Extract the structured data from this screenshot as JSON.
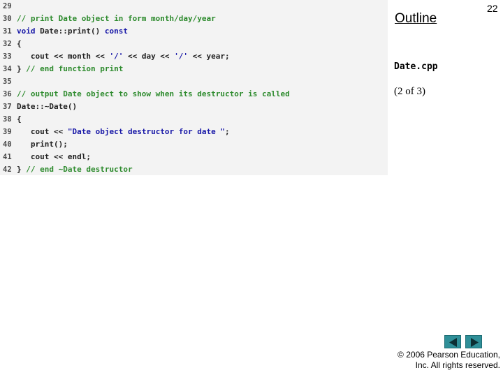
{
  "code": {
    "lines": [
      {
        "num": "29",
        "tokens": []
      },
      {
        "num": "30",
        "tokens": [
          {
            "t": "// print Date object in form month/day/year",
            "k": "comment"
          }
        ]
      },
      {
        "num": "31",
        "tokens": [
          {
            "t": "void",
            "k": "keyword"
          },
          {
            "t": " Date::print() ",
            "k": "plain"
          },
          {
            "t": "const",
            "k": "keyword"
          }
        ]
      },
      {
        "num": "32",
        "tokens": [
          {
            "t": "{",
            "k": "plain"
          }
        ]
      },
      {
        "num": "33",
        "tokens": [
          {
            "t": "   cout << month << ",
            "k": "plain"
          },
          {
            "t": "'/'",
            "k": "string"
          },
          {
            "t": " << day << ",
            "k": "plain"
          },
          {
            "t": "'/'",
            "k": "string"
          },
          {
            "t": " << year;",
            "k": "plain"
          }
        ]
      },
      {
        "num": "34",
        "tokens": [
          {
            "t": "} ",
            "k": "plain"
          },
          {
            "t": "// end function print",
            "k": "comment"
          }
        ]
      },
      {
        "num": "35",
        "tokens": []
      },
      {
        "num": "36",
        "tokens": [
          {
            "t": "// output Date object to show when its destructor is called",
            "k": "comment"
          }
        ]
      },
      {
        "num": "37",
        "tokens": [
          {
            "t": "Date::~Date()",
            "k": "plain"
          }
        ]
      },
      {
        "num": "38",
        "tokens": [
          {
            "t": "{",
            "k": "plain"
          }
        ]
      },
      {
        "num": "39",
        "tokens": [
          {
            "t": "   cout << ",
            "k": "plain"
          },
          {
            "t": "\"Date object destructor for date \"",
            "k": "string"
          },
          {
            "t": ";",
            "k": "plain"
          }
        ]
      },
      {
        "num": "40",
        "tokens": [
          {
            "t": "   print();",
            "k": "plain"
          }
        ]
      },
      {
        "num": "41",
        "tokens": [
          {
            "t": "   cout << endl;",
            "k": "plain"
          }
        ]
      },
      {
        "num": "42",
        "tokens": [
          {
            "t": "} ",
            "k": "plain"
          },
          {
            "t": "// end ~Date destructor",
            "k": "comment"
          }
        ]
      }
    ]
  },
  "sidebar": {
    "outline_label": "Outline",
    "page_number": "22",
    "file_name": "Date.cpp",
    "page_of": "(2 of 3)"
  },
  "nav": {
    "prev_icon": "triangle-left-icon",
    "next_icon": "triangle-right-icon",
    "button_color": "#2f8f98"
  },
  "footer": {
    "copyright_line1": "© 2006 Pearson Education,",
    "copyright_line2": "Inc.  All rights reserved."
  }
}
